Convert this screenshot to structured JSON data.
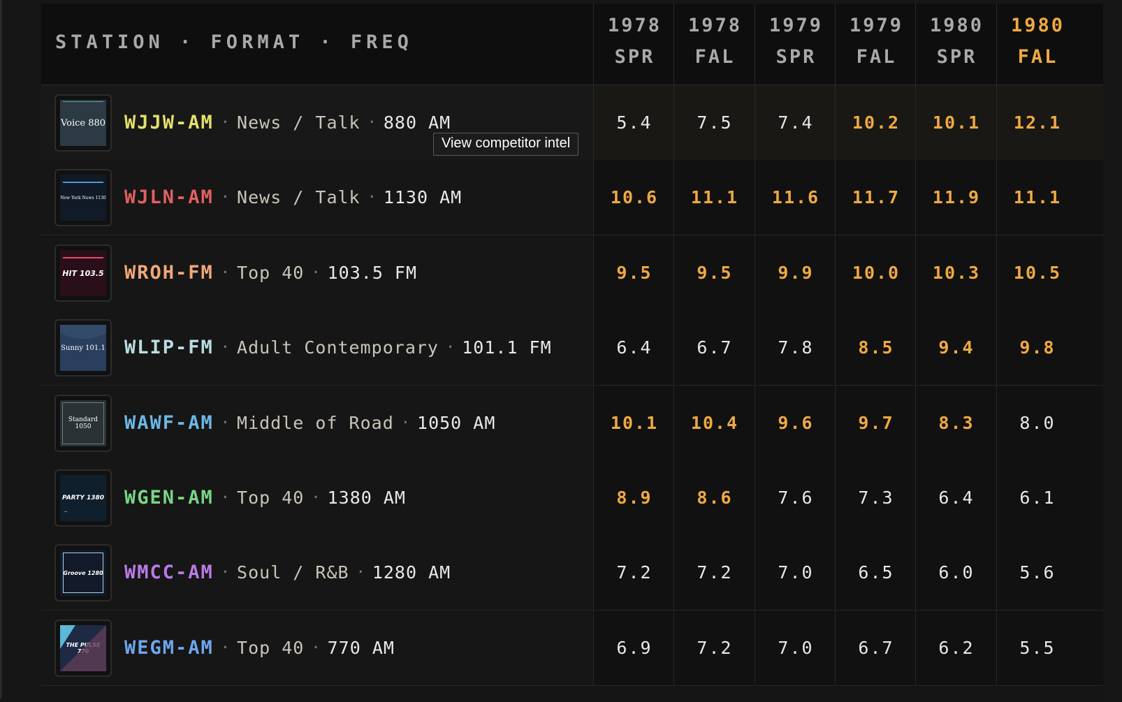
{
  "header": {
    "station_label": "STATION · FORMAT · FREQ",
    "columns": [
      {
        "year": "1978",
        "season": "SPR"
      },
      {
        "year": "1978",
        "season": "FAL"
      },
      {
        "year": "1979",
        "season": "SPR"
      },
      {
        "year": "1979",
        "season": "FAL"
      },
      {
        "year": "1980",
        "season": "SPR"
      },
      {
        "year": "1980",
        "season": "FAL"
      }
    ],
    "current_column_color": "#f0a941"
  },
  "tooltip": {
    "text": "View competitor intel"
  },
  "highlight_color": "#f0a941",
  "rows": [
    {
      "callsign": "WJJW-AM",
      "color": "#e4df6a",
      "format": "News / Talk",
      "freq": "880 AM",
      "logo": {
        "text": "Voice 880",
        "bg": "#2c3a44",
        "accent": "#6aa7a3"
      },
      "values": [
        "5.4",
        "7.5",
        "7.4",
        "10.2",
        "10.1",
        "12.1"
      ],
      "highlighted": [
        false,
        false,
        false,
        true,
        true,
        true
      ]
    },
    {
      "callsign": "WJLN-AM",
      "color": "#e35f5f",
      "format": "News / Talk",
      "freq": "1130 AM",
      "logo": {
        "text": "New York News 1130",
        "bg": "#111a27",
        "accent": "#5b93d6"
      },
      "values": [
        "10.6",
        "11.1",
        "11.6",
        "11.7",
        "11.9",
        "11.1"
      ],
      "highlighted": [
        true,
        true,
        true,
        true,
        true,
        true
      ]
    },
    {
      "callsign": "WROH-FM",
      "color": "#f0a878",
      "format": "Top 40",
      "freq": "103.5 FM",
      "logo": {
        "text": "HIT 103.5",
        "bg": "#2a0f1a",
        "accent": "#e64a6d"
      },
      "values": [
        "9.5",
        "9.5",
        "9.9",
        "10.0",
        "10.3",
        "10.5"
      ],
      "highlighted": [
        true,
        true,
        true,
        true,
        true,
        true
      ]
    },
    {
      "callsign": "WLIP-FM",
      "color": "#b9dde0",
      "format": "Adult Contemporary",
      "freq": "101.1 FM",
      "logo": {
        "text": "Sunny 101.1",
        "bg": "#2a3f5e",
        "accent": "#3d5678"
      },
      "values": [
        "6.4",
        "6.7",
        "7.8",
        "8.5",
        "9.4",
        "9.8"
      ],
      "highlighted": [
        false,
        false,
        false,
        true,
        true,
        true
      ]
    },
    {
      "callsign": "WAWF-AM",
      "color": "#6cb8e8",
      "format": "Middle of Road",
      "freq": "1050 AM",
      "logo": {
        "text": "Standard 1050",
        "bg": "#2a3234",
        "accent": "#6d7d7f"
      },
      "values": [
        "10.1",
        "10.4",
        "9.6",
        "9.7",
        "8.3",
        "8.0"
      ],
      "highlighted": [
        true,
        true,
        true,
        true,
        true,
        false
      ]
    },
    {
      "callsign": "WGEN-AM",
      "color": "#79d684",
      "format": "Top 40",
      "freq": "1380 AM",
      "logo": {
        "text": "PARTY 1380",
        "bg": "#0f1f2c",
        "accent": "#1d3344"
      },
      "values": [
        "8.9",
        "8.6",
        "7.6",
        "7.3",
        "6.4",
        "6.1"
      ],
      "highlighted": [
        true,
        true,
        false,
        false,
        false,
        false
      ]
    },
    {
      "callsign": "WMCC-AM",
      "color": "#b97be6",
      "format": "Soul / R&B",
      "freq": "1280 AM",
      "logo": {
        "text": "Groove 1280",
        "bg": "#131a2a",
        "accent": "#a7d6e8"
      },
      "values": [
        "7.2",
        "7.2",
        "7.0",
        "6.5",
        "6.0",
        "5.6"
      ],
      "highlighted": [
        false,
        false,
        false,
        false,
        false,
        false
      ]
    },
    {
      "callsign": "WEGM-AM",
      "color": "#6fa6f0",
      "format": "Top 40",
      "freq": "770 AM",
      "logo": {
        "text": "THE PULSE 770",
        "bg": "#1e2a44",
        "accent": "#5bb8d8"
      },
      "values": [
        "6.9",
        "7.2",
        "7.0",
        "6.7",
        "6.2",
        "5.5"
      ],
      "highlighted": [
        false,
        false,
        false,
        false,
        false,
        false
      ]
    }
  ]
}
